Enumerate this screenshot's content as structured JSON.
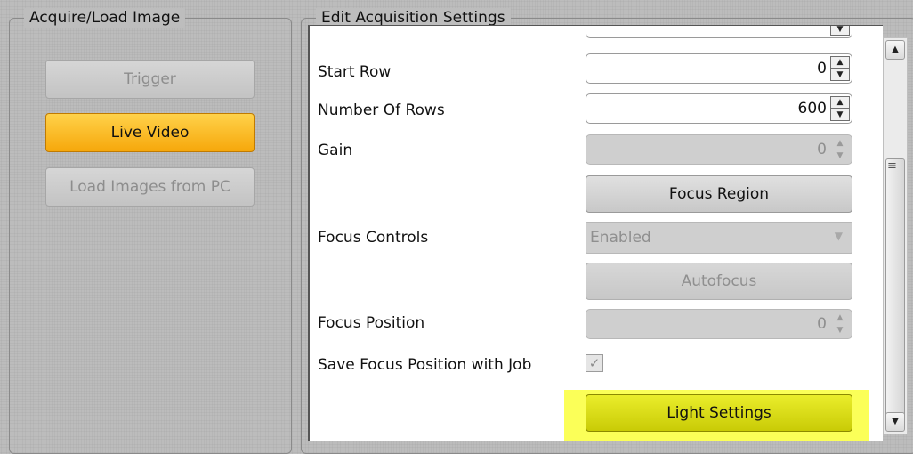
{
  "left_panel": {
    "title": "Acquire/Load Image",
    "buttons": {
      "trigger": "Trigger",
      "live_video": "Live Video",
      "load_images": "Load Images from PC"
    }
  },
  "right_panel": {
    "title": "Edit Acquisition Settings",
    "rows": {
      "start_row": {
        "label": "Start Row",
        "value": "0"
      },
      "number_of_rows": {
        "label": "Number Of Rows",
        "value": "600"
      },
      "gain": {
        "label": "Gain",
        "value": "0"
      },
      "focus_region": {
        "label": "Focus Region"
      },
      "focus_controls": {
        "label": "Focus Controls",
        "value": "Enabled"
      },
      "autofocus": {
        "label": "Autofocus"
      },
      "focus_position": {
        "label": "Focus Position",
        "value": "0"
      },
      "save_focus": {
        "label": "Save Focus Position with Job",
        "checked": true
      },
      "light_settings": {
        "label": "Light Settings"
      }
    }
  },
  "icons": {
    "spin_up": "▲",
    "spin_down": "▼",
    "combo_arrow": "▼",
    "check": "✓",
    "scroll_up": "▲",
    "scroll_down": "▼",
    "grip": "≡"
  },
  "colors": {
    "live_video": "#f6a80b",
    "highlight": "#fbff58",
    "light_settings": "#dcdf12"
  }
}
